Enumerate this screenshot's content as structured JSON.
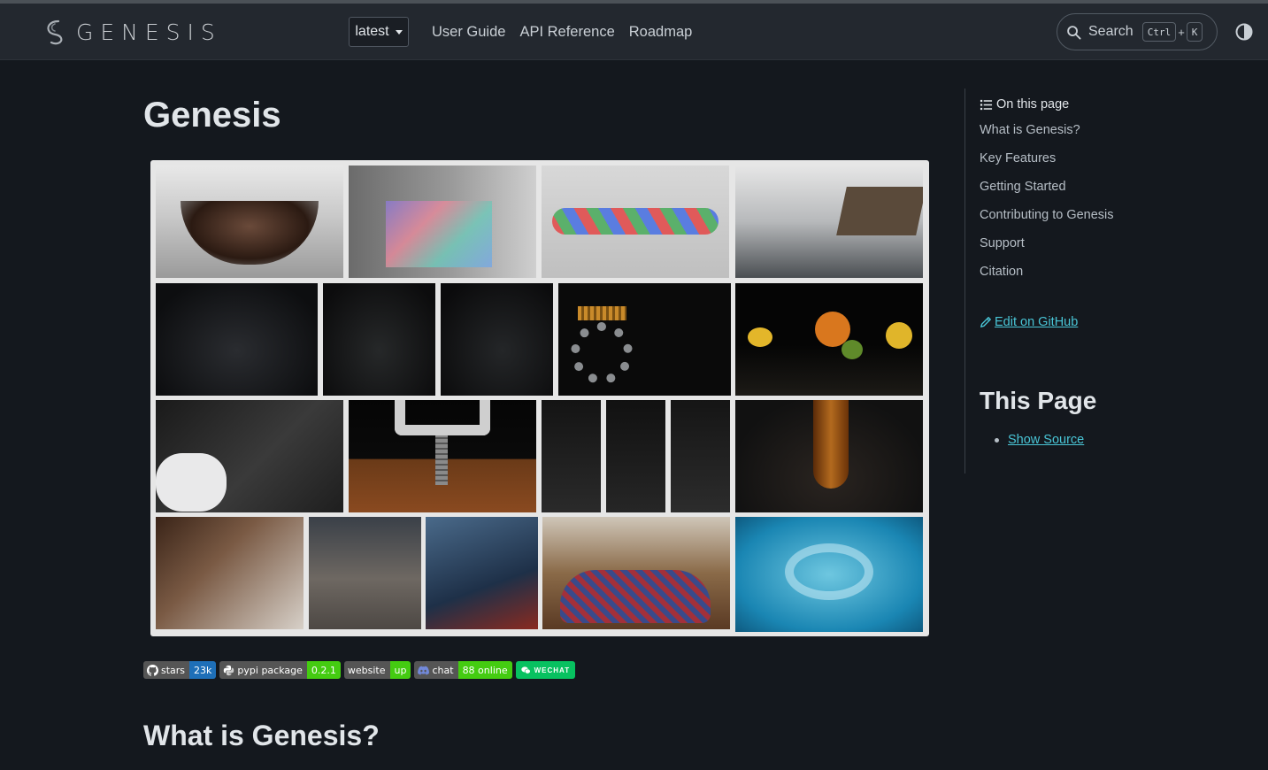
{
  "header": {
    "logo_text": "GENESIS",
    "version": "latest",
    "nav": [
      "User Guide",
      "API Reference",
      "Roadmap"
    ],
    "search_label": "Search",
    "shortcut_ctrl": "Ctrl",
    "shortcut_plus": "+",
    "shortcut_key": "K"
  },
  "main": {
    "title": "Genesis",
    "section_heading": "What is Genesis?",
    "badges": [
      {
        "label": "stars",
        "value": "23k",
        "color": "#1e6fb8"
      },
      {
        "label": "pypi package",
        "value": "0.2.1",
        "color": "#4c1"
      },
      {
        "label": "website",
        "value": "up",
        "color": "#4c1"
      },
      {
        "label": "chat",
        "value": "88 online",
        "color": "#4c1"
      }
    ],
    "wechat_badge": "WECHAT"
  },
  "sidebar": {
    "toc_title": "On this page",
    "toc_items": [
      "What is Genesis?",
      "Key Features",
      "Getting Started",
      "Contributing to Genesis",
      "Support",
      "Citation"
    ],
    "edit_link": "Edit on GitHub",
    "this_page_heading": "This Page",
    "show_source": "Show Source"
  },
  "colors": {
    "background": "#14181e",
    "header": "#23282f",
    "link": "#49c5d6"
  }
}
